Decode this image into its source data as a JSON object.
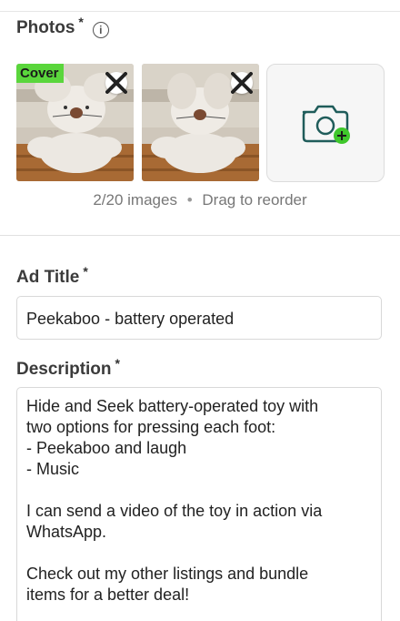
{
  "photos_section": {
    "label": "Photos",
    "required_mark": "*",
    "info_icon": "info-circle-icon",
    "photos": [
      {
        "badge": "Cover",
        "remove_icon": "close-icon"
      },
      {
        "remove_icon": "close-icon"
      }
    ],
    "add_icon": "camera-plus-icon",
    "count_text": "2/20 images",
    "separator": "•",
    "hint_text": "Drag to reorder"
  },
  "ad_title": {
    "label": "Ad Title",
    "required_mark": "*",
    "value": "Peekaboo - battery operated"
  },
  "description": {
    "label": "Description",
    "required_mark": "*",
    "value": "Hide and Seek battery-operated toy with\ntwo options for pressing each foot:\n- Peekaboo and laugh\n- Music\n\nI can send a video of the toy in action via\nWhatsApp.\n\nCheck out my other listings and bundle\nitems for a better deal!"
  },
  "colors": {
    "accent_green": "#5ad63c",
    "add_icon_teal": "#1f5c5a"
  }
}
